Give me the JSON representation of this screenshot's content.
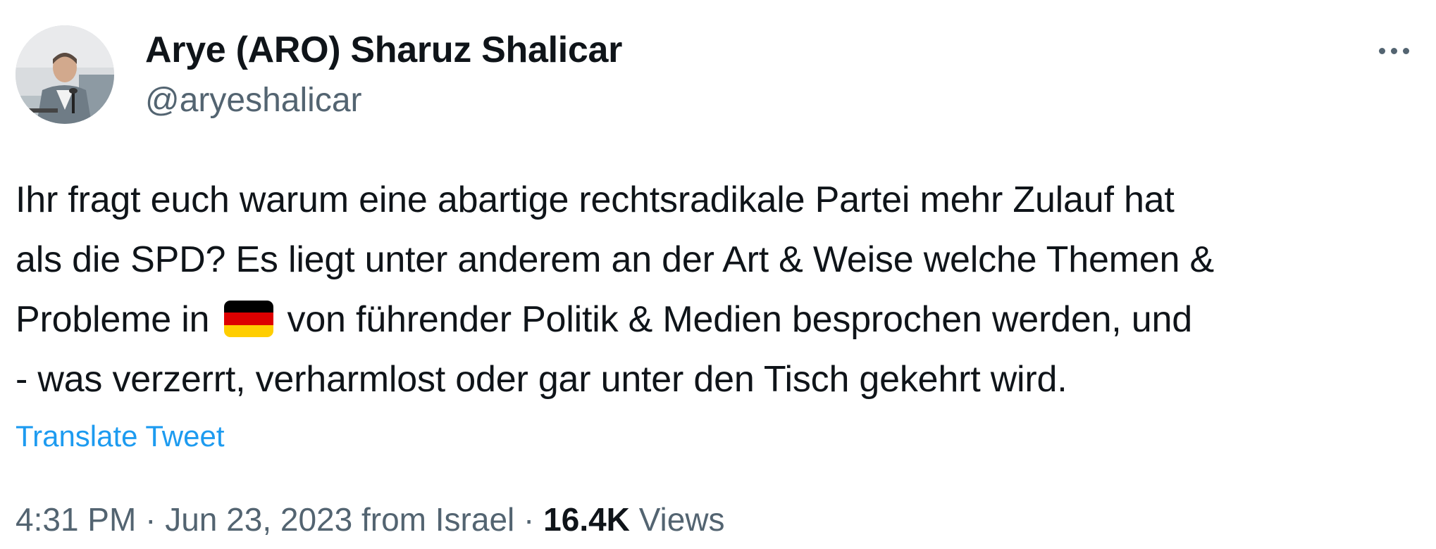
{
  "author": {
    "display_name": "Arye (ARO) Sharuz Shalicar",
    "handle": "@aryeshalicar",
    "avatar_icon": "profile-photo"
  },
  "menu": {
    "icon": "more-horizontal-icon"
  },
  "tweet": {
    "lines": {
      "l1": "Ihr fragt euch warum eine abartige rechtsradikale Partei mehr Zulauf hat",
      "l2": "als die SPD? Es liegt unter anderem an der Art & Weise welche Themen &",
      "l3a": "Probleme in",
      "l3b": "von führender Politik & Medien besprochen werden, und",
      "l4": "- was verzerrt, verharmlost oder gar unter den Tisch gekehrt wird."
    },
    "flag_emoji": {
      "icon": "germany-flag-emoji",
      "colors": [
        "#000000",
        "#dd0000",
        "#ffce00"
      ]
    },
    "translate_label": "Translate Tweet"
  },
  "meta": {
    "time": "4:31 PM",
    "separator": "·",
    "date": "Jun 23, 2023",
    "location": "from Israel",
    "views_count": "16.4K",
    "views_label": "Views"
  },
  "colors": {
    "accent": "#1d9bf0",
    "text_primary": "#0f1419",
    "text_secondary": "#536471"
  }
}
